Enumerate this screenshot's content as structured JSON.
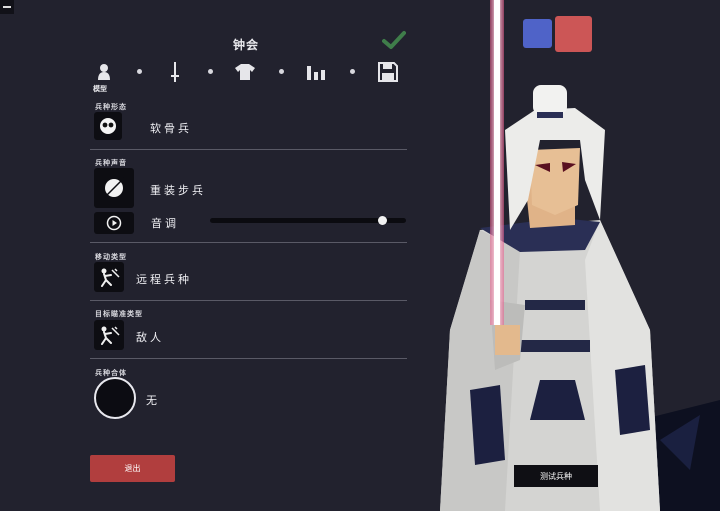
{
  "header": {
    "title": "钟会"
  },
  "steps": [
    {
      "icon": "person-icon",
      "label": "模型"
    },
    {
      "icon": "sword-icon",
      "label": ""
    },
    {
      "icon": "shirt-icon",
      "label": ""
    },
    {
      "icon": "bar-chart-icon",
      "label": ""
    },
    {
      "icon": "save-icon",
      "label": ""
    }
  ],
  "sections": {
    "emblem": {
      "label": "兵种形态",
      "value": "软骨兵",
      "icon": "skull-face-icon"
    },
    "voice": {
      "label": "兵种声音",
      "value": "重装步兵",
      "icon": "voice-orb-icon",
      "pitch_label": "音调",
      "pitch_value": 0.88,
      "pitch_icon": "play-icon"
    },
    "movement": {
      "label": "移动类型",
      "value": "远程兵种",
      "icon": "ranged-unit-icon"
    },
    "targeting": {
      "label": "目标瞄准类型",
      "value": "敌人",
      "icon": "target-enemy-icon"
    },
    "fusion": {
      "label": "兵种合体",
      "value": "无"
    }
  },
  "buttons": {
    "exit": "退出",
    "test": "测试兵种",
    "confirm_icon": "checkmark-icon"
  },
  "colors": {
    "primary": "#4f63c8",
    "secondary": "#cc5656",
    "exit": "#b13e3e",
    "background": "#22222e"
  }
}
